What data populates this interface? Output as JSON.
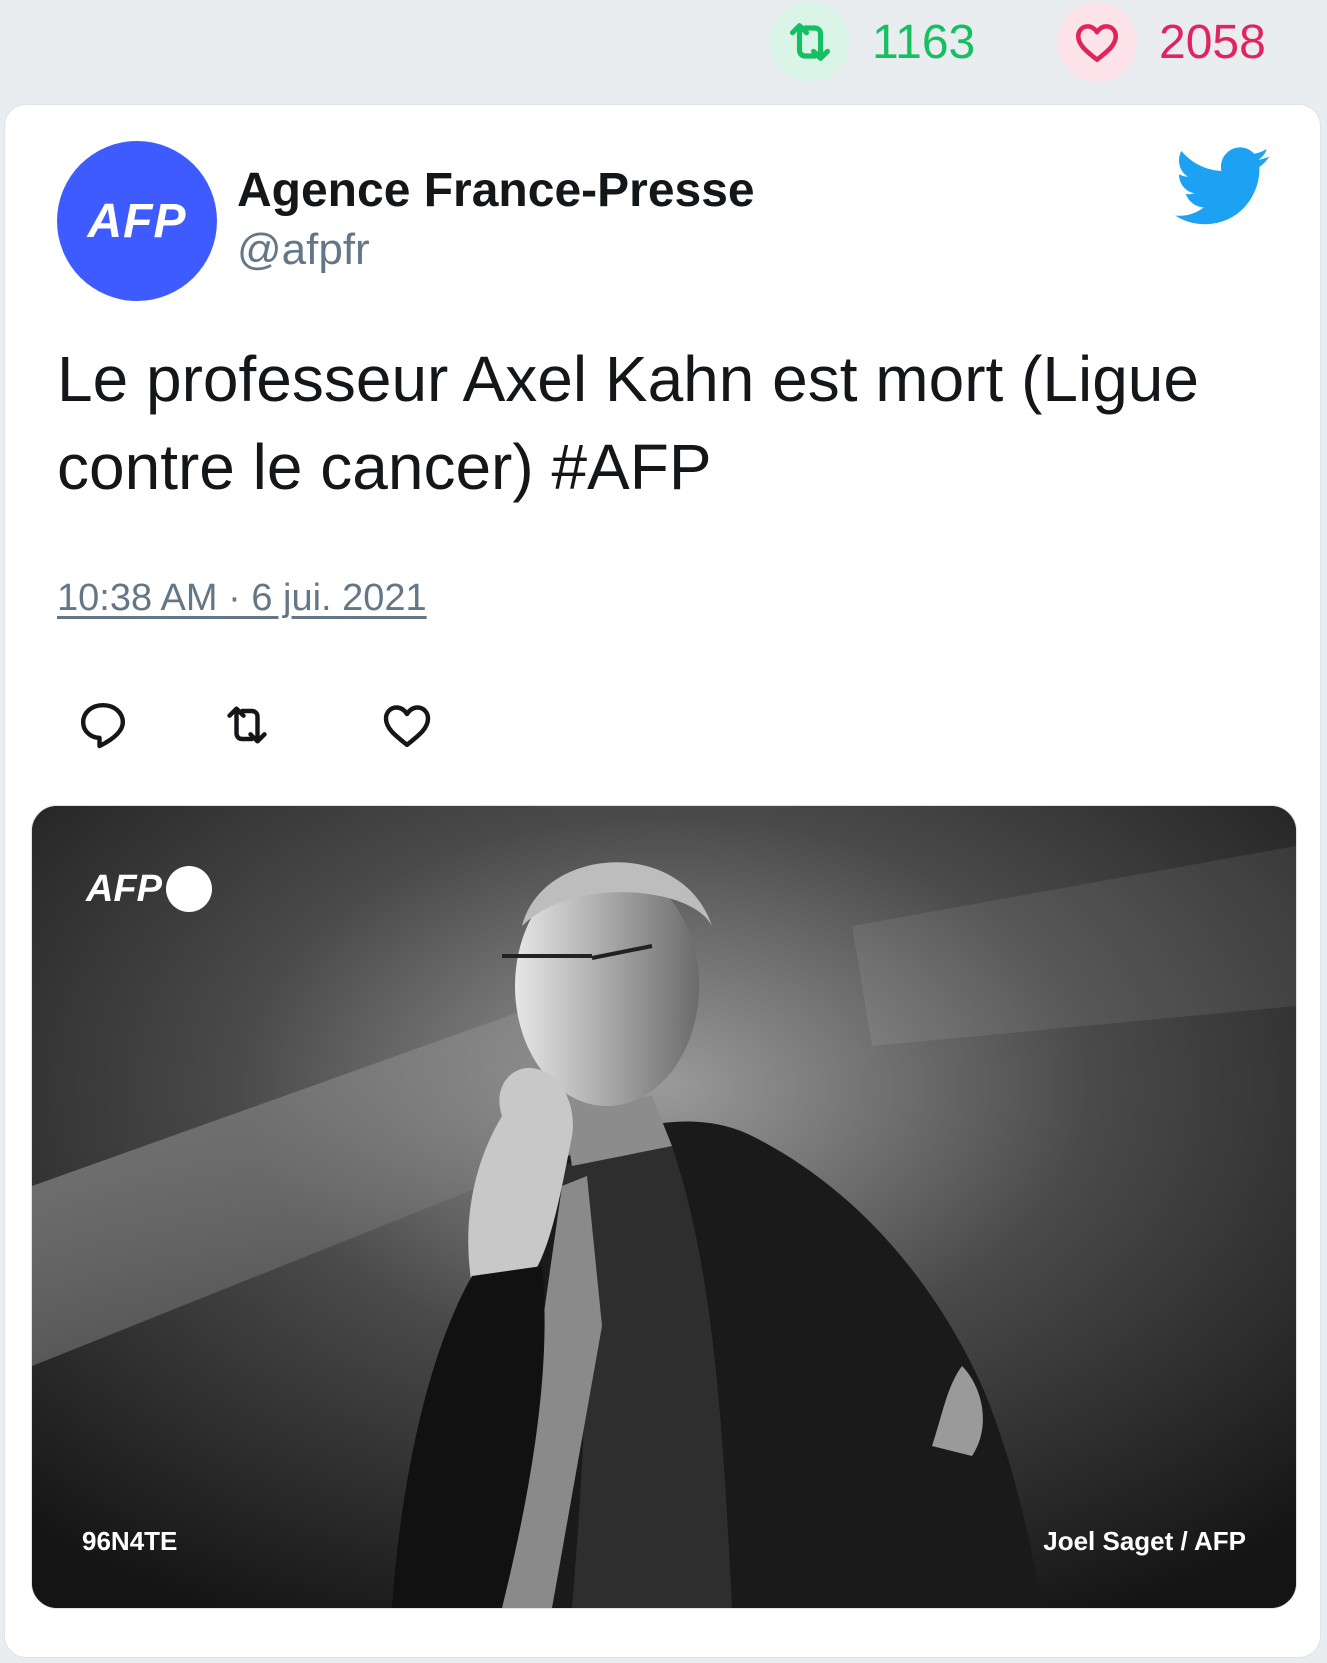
{
  "stats": {
    "retweets": "1163",
    "likes": "2058",
    "retweet_icon": "retweet-icon",
    "like_icon": "heart-icon",
    "retweet_color": "#17bf63",
    "like_color": "#e0245e"
  },
  "author": {
    "avatar_text": "AFP",
    "avatar_color": "#3e5bff",
    "display_name": "Agence France-Presse",
    "handle": "@afpfr"
  },
  "tweet": {
    "text": "Le professeur Axel Kahn est mort (Ligue contre le cancer) #AFP",
    "timestamp": "10:38 AM · 6 jui. 2021"
  },
  "actions": {
    "reply_icon": "reply-icon",
    "retweet_icon": "retweet-icon",
    "like_icon": "heart-icon"
  },
  "media": {
    "watermark": "AFP",
    "photo_id": "96N4TE",
    "credit": "Joel Saget / AFP"
  },
  "brand": {
    "twitter_icon": "twitter-bird-icon",
    "twitter_color": "#1da1f2"
  }
}
